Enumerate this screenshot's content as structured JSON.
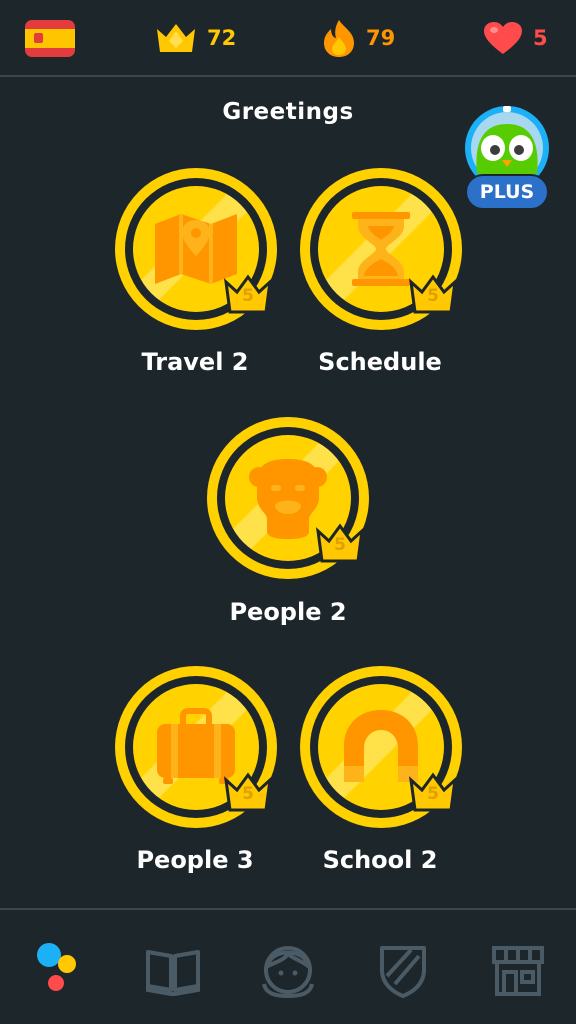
{
  "header": {
    "crowns": "72",
    "streak": "79",
    "hearts": "5"
  },
  "section_title": "Greetings",
  "plus_badge": "PLUS",
  "skills": [
    {
      "label": "Travel 2",
      "level": "5",
      "icon": "map-icon"
    },
    {
      "label": "Schedule",
      "level": "5",
      "icon": "hourglass-icon"
    },
    {
      "label": "People 2",
      "level": "5",
      "icon": "face-icon"
    },
    {
      "label": "People 3",
      "level": "5",
      "icon": "suitcase-icon"
    },
    {
      "label": "School 2",
      "level": "5",
      "icon": "magnet-icon"
    }
  ],
  "colors": {
    "background": "#1d262b",
    "gold": "#ffd100",
    "crown": "#ffc800",
    "flame": "#ff9600",
    "heart": "#ff4b4b",
    "plus_blue": "#1cb0f6"
  },
  "bottom_nav": [
    "learn-icon",
    "stories-icon",
    "profile-icon",
    "leagues-icon",
    "shop-icon"
  ]
}
